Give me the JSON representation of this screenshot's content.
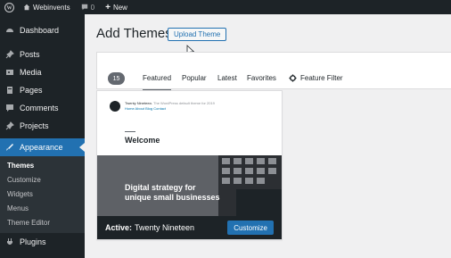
{
  "adminbar": {
    "site_name": "Webinvents",
    "comment_count": "0",
    "new_label": "New"
  },
  "sidebar": {
    "items": [
      {
        "label": "Dashboard",
        "icon": "dashboard-icon"
      },
      {
        "label": "Posts",
        "icon": "pin-icon"
      },
      {
        "label": "Media",
        "icon": "media-icon"
      },
      {
        "label": "Pages",
        "icon": "pages-icon"
      },
      {
        "label": "Comments",
        "icon": "comment-icon"
      },
      {
        "label": "Projects",
        "icon": "pin-icon"
      },
      {
        "label": "Appearance",
        "icon": "brush-icon"
      }
    ],
    "submenu": [
      "Themes",
      "Customize",
      "Widgets",
      "Menus",
      "Theme Editor"
    ],
    "plugins": {
      "label": "Plugins",
      "icon": "plug-icon"
    }
  },
  "page": {
    "title": "Add Themes",
    "upload_label": "Upload Theme"
  },
  "filter": {
    "count": "15",
    "tabs": [
      "Featured",
      "Popular",
      "Latest",
      "Favorites"
    ],
    "feature_filter": "Feature Filter"
  },
  "theme": {
    "site_title": "Twenty Nineteen",
    "site_desc": "— The WordPress default theme for 2019",
    "site_nav": "Home  About  Blog  Contact",
    "welcome": "Welcome",
    "tagline": "Digital strategy for unique small businesses",
    "active_label": "Active:",
    "name": "Twenty Nineteen",
    "customize_label": "Customize"
  },
  "colors": {
    "admin_dark": "#1d2327",
    "accent": "#2271b1"
  }
}
